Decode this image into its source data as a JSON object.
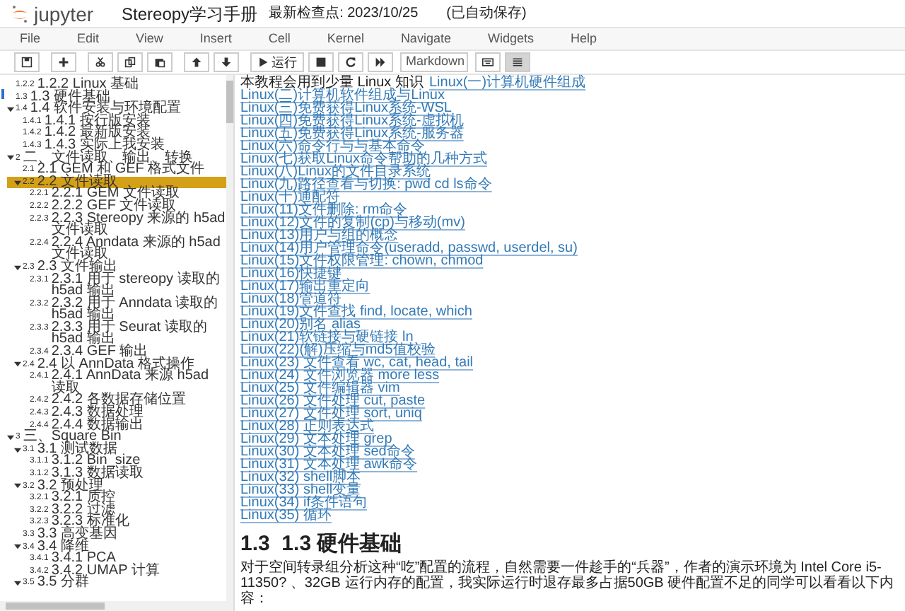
{
  "header": {
    "logo_text": "jupyter",
    "title": "Stereopy学习手册",
    "checkpoint": "最新检查点: 2023/10/25",
    "autosave": "(已自动保存)"
  },
  "menu": [
    "File",
    "Edit",
    "View",
    "Insert",
    "Cell",
    "Kernel",
    "Navigate",
    "Widgets",
    "Help"
  ],
  "toolbar": {
    "run_label": "运行",
    "cell_type": "Markdown",
    "toc_active": true
  },
  "toc": [
    {
      "number": "1.2.2",
      "label": "1.2.2 Linux 基础",
      "selected": false
    },
    {
      "number": "1.3",
      "label": "1.3 硬件基础",
      "selected": false
    },
    {
      "number": "1.4",
      "label": "1.4 软件安装与环境配置",
      "selected": false,
      "expanded": true,
      "children": [
        {
          "number": "1.4.1",
          "label": "1.4.1 按行版安装",
          "selected": false
        },
        {
          "number": "1.4.2",
          "label": "1.4.2 最新版安装",
          "selected": false
        },
        {
          "number": "1.4.3",
          "label": "1.4.3 实际上我安装",
          "selected": false
        }
      ]
    },
    {
      "number": "2",
      "label": "二、文件读取、输出、转换",
      "selected": false,
      "expanded": true,
      "children": [
        {
          "number": "2.1",
          "label": "2.1 GEM 和 GEF 格式文件",
          "selected": false
        },
        {
          "number": "2.2",
          "label": "2.2 文件读取",
          "selected": true,
          "expanded": true,
          "children": [
            {
              "number": "2.2.1",
              "label": "2.2.1 GEM 文件读取",
              "selected": false
            },
            {
              "number": "2.2.2",
              "label": "2.2.2 GEF 文件读取",
              "selected": false
            },
            {
              "number": "2.2.3",
              "label": "2.2.3 Stereopy 来源的 h5ad 文件读取",
              "selected": false
            },
            {
              "number": "2.2.4",
              "label": "2.2.4 Anndata 来源的 h5ad 文件读取",
              "selected": false
            }
          ]
        },
        {
          "number": "2.3",
          "label": "2.3 文件输出",
          "selected": false,
          "expanded": true,
          "children": [
            {
              "number": "2.3.1",
              "label": "2.3.1 用于 stereopy 读取的 h5ad 输出",
              "selected": false
            },
            {
              "number": "2.3.2",
              "label": "2.3.2 用于 Anndata 读取的 h5ad 输出",
              "selected": false
            },
            {
              "number": "2.3.3",
              "label": "2.3.3 用于 Seurat 读取的 h5ad 输出",
              "selected": false
            },
            {
              "number": "2.3.4",
              "label": "2.3.4 GEF 输出",
              "selected": false
            }
          ]
        },
        {
          "number": "2.4",
          "label": "2.4 以 AnnData 格式操作",
          "selected": false,
          "expanded": true,
          "children": [
            {
              "number": "2.4.1",
              "label": "2.4.1 AnnData 来源 h5ad 读取",
              "selected": false
            },
            {
              "number": "2.4.2",
              "label": "2.4.2 各数据存储位置",
              "selected": false
            },
            {
              "number": "2.4.3",
              "label": "2.4.3 数据处理",
              "selected": false
            },
            {
              "number": "2.4.4",
              "label": "2.4.4 数据输出",
              "selected": false
            }
          ]
        }
      ]
    },
    {
      "number": "3",
      "label": "三、Square Bin",
      "selected": false,
      "expanded": true,
      "children": [
        {
          "number": "3.1",
          "label": "3.1 测试数据",
          "selected": false,
          "expanded": true,
          "children": [
            {
              "number": "3.1.1",
              "label": "3.1.2 Bin_size",
              "selected": false
            },
            {
              "number": "3.1.2",
              "label": "3.1.3 数据读取",
              "selected": false
            }
          ]
        },
        {
          "number": "3.2",
          "label": "3.2 预处理",
          "selected": false,
          "expanded": true,
          "children": [
            {
              "number": "3.2.1",
              "label": "3.2.1 质控",
              "selected": false
            },
            {
              "number": "3.2.2",
              "label": "3.2.2 过滤",
              "selected": false
            },
            {
              "number": "3.2.3",
              "label": "3.2.3 标准化",
              "selected": false
            }
          ]
        },
        {
          "number": "3.3",
          "label": "3.3 高变基因",
          "selected": false
        },
        {
          "number": "3.4",
          "label": "3.4 降维",
          "selected": false,
          "expanded": true,
          "children": [
            {
              "number": "3.4.1",
              "label": "3.4.1 PCA",
              "selected": false
            },
            {
              "number": "3.4.2",
              "label": "3.4.2 UMAP 计算",
              "selected": false
            }
          ]
        },
        {
          "number": "3.5",
          "label": "3.5 分群",
          "selected": false,
          "expanded": true
        }
      ]
    }
  ],
  "content": {
    "intro": "本教程会用到少量 Linux 知识",
    "links": [
      "Linux(一)计算机硬件组成",
      "Linux(二)计算机软件组成与Linux",
      "Linux(三)免费获得Linux系统-WSL",
      "Linux(四)免费获得Linux系统-虚拟机",
      "Linux(五)免费获得Linux系统-服务器",
      "Linux(六)命令行与与基本命令",
      "Linux(七)获取Linux命令帮助的几种方式",
      "Linux(八)Linux的文件目录系统",
      "Linux(九)路径查看与切换: pwd cd ls命令",
      "Linux(十)通配符",
      "Linux(11)文件删除: rm命令",
      "Linux(12)文件的复制(cp)与移动(mv)",
      "Linux(13)用户与组的概念",
      "Linux(14)用户管理命令(useradd, passwd, userdel, su)",
      "Linux(15)文件权限管理: chown, chmod",
      "Linux(16)快捷键",
      "Linux(17)输出重定向",
      "Linux(18)管道符",
      "Linux(19)文件查找 find, locate, which",
      "Linux(20)别名 alias",
      "Linux(21)软链接与硬链接 ln",
      "Linux(22)(解)压缩与md5值校验",
      "Linux(23) 文件查看 wc, cat, head, tail",
      "Linux(24) 文件浏览器 more less",
      "Linux(25) 文件编辑器 vim",
      "Linux(26) 文件处理 cut, paste",
      "Linux(27) 文件处理 sort, uniq",
      "Linux(28) 正则表达式",
      "Linux(29) 文本处理 grep",
      "Linux(30) 文本处理 sed命令",
      "Linux(31) 文本处理 awk命令",
      "Linux(32) shell脚本",
      "Linux(33) shell变量",
      "Linux(34) if条件语句",
      "Linux(35) 循环"
    ],
    "heading_number": "1.3",
    "heading": "1.3 硬件基础",
    "paragraph": "对于空间转录组分析这种“吃”配置的流程，自然需要一件趁手的“兵器”，作者的演示环境为 Intel Core i5-11350? 、32GB 运行内存的配置，我实际运行时退存最多占据50GB 硬件配置不足的同学可以看看以下内容："
  }
}
